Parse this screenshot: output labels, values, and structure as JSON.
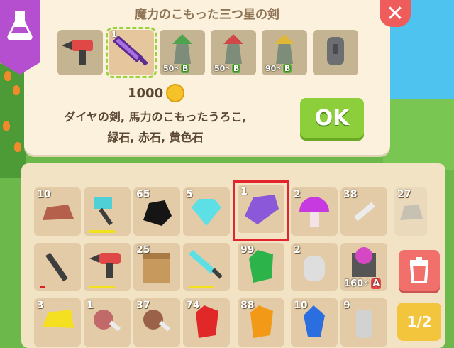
{
  "craft": {
    "title": "魔力のこもった三つ星の剣",
    "price": "1000",
    "recipe_line1": "ダイヤの剣, 馬力のこもったうろこ,",
    "recipe_line2": "緑石, 赤石, 黄色石",
    "ok_label": "OK",
    "close_label": "✕",
    "slots": [
      {
        "icon": "drill-icon",
        "selected": false,
        "badge": ""
      },
      {
        "icon": "crystal-sword-icon",
        "selected": true,
        "badge": ""
      },
      {
        "icon": "green-tower-icon",
        "selected": false,
        "badge": "50",
        "grade": "B"
      },
      {
        "icon": "red-tower-icon",
        "selected": false,
        "badge": "50",
        "grade": "B"
      },
      {
        "icon": "yellow-tower-icon",
        "selected": false,
        "badge": "90",
        "grade": "B"
      },
      {
        "icon": "stone-statue-icon",
        "selected": false,
        "badge": ""
      }
    ],
    "selected_slot_number": "1"
  },
  "inventory": {
    "rows": [
      [
        {
          "name": "brick",
          "count": "10",
          "icon": "brick-icon"
        },
        {
          "name": "hammer",
          "count": "",
          "icon": "hammer-icon",
          "durability_color": "#f2e21a"
        },
        {
          "name": "coal",
          "count": "65",
          "icon": "coal-icon"
        },
        {
          "name": "diamond",
          "count": "5",
          "icon": "diamond-icon"
        },
        {
          "name": "magic-scale",
          "count": "1",
          "icon": "purple-scale-icon"
        },
        {
          "name": "mushroom",
          "count": "2",
          "icon": "purple-mushroom-icon"
        },
        {
          "name": "bone",
          "count": "38",
          "icon": "bone-icon"
        },
        {
          "name": "stone",
          "count": "27",
          "icon": "stone-icon"
        }
      ],
      [
        {
          "name": "wrench",
          "count": "",
          "icon": "wrench-icon",
          "durability_color": "#e02020"
        },
        {
          "name": "drill",
          "count": "",
          "icon": "drill-icon",
          "durability_color": "#f2e21a"
        },
        {
          "name": "wood-block",
          "count": "25",
          "icon": "wood-block-icon"
        },
        {
          "name": "diamond-sword",
          "count": "",
          "icon": "diamond-sword-icon",
          "durability_color": "#f2e21a"
        },
        {
          "name": "green-stone",
          "count": "99",
          "icon": "green-gem-icon"
        },
        {
          "name": "sack",
          "count": "2",
          "icon": "sack-icon"
        },
        {
          "name": "purple-tower",
          "count": "160",
          "icon": "purple-tower-icon",
          "grade": "A"
        }
      ],
      [
        {
          "name": "yellow-stone",
          "count": "3",
          "icon": "yellow-gem-icon"
        },
        {
          "name": "meat",
          "count": "1",
          "icon": "meat-icon"
        },
        {
          "name": "roast-meat",
          "count": "37",
          "icon": "roast-meat-icon"
        },
        {
          "name": "red-stone",
          "count": "74",
          "icon": "red-gem-icon"
        },
        {
          "name": "orange-gem",
          "count": "88",
          "icon": "orange-gem-icon"
        },
        {
          "name": "blue-gem",
          "count": "10",
          "icon": "blue-gem-icon"
        },
        {
          "name": "log",
          "count": "9",
          "icon": "log-icon"
        }
      ]
    ],
    "trash_icon": "trash-icon",
    "page_label": "1/2"
  }
}
